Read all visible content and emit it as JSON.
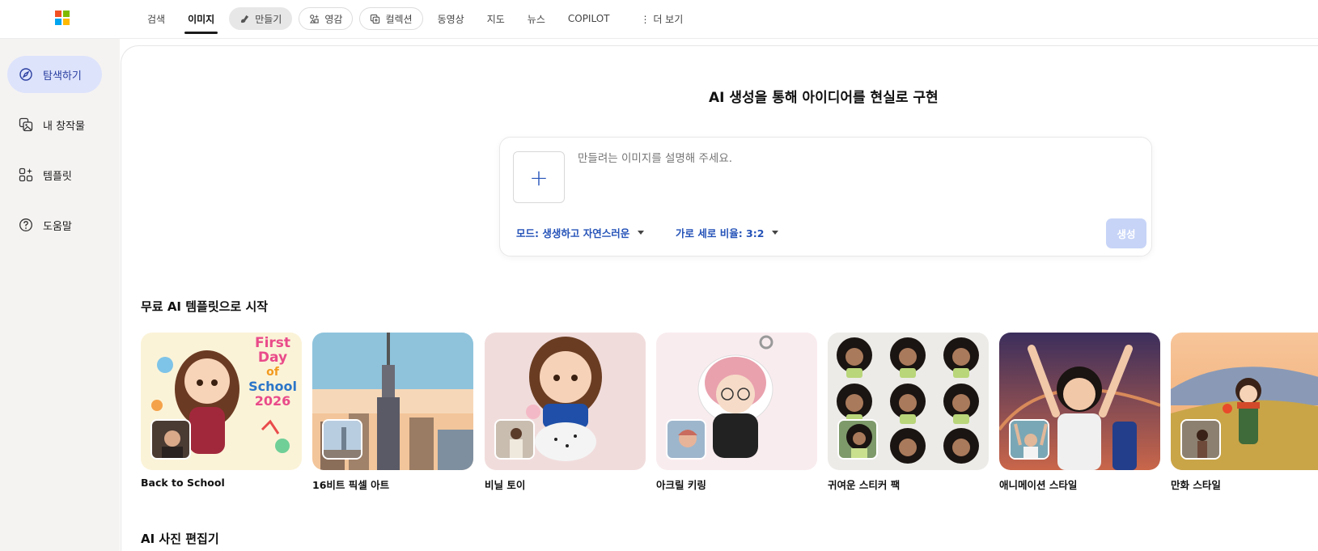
{
  "colors": {
    "accent": "#2553b8",
    "sidebar_active": "#dde3fb",
    "generate_disabled": "#c7d4f7",
    "logo": [
      "#f25022",
      "#7fba00",
      "#00a4ef",
      "#ffb900"
    ]
  },
  "nav": {
    "tabs": [
      {
        "label": "검색"
      },
      {
        "label": "이미지"
      },
      {
        "label": "만들기"
      },
      {
        "label": "영감"
      },
      {
        "label": "컬렉션"
      },
      {
        "label": "동영상"
      },
      {
        "label": "지도"
      },
      {
        "label": "뉴스"
      },
      {
        "label": "COPILOT"
      },
      {
        "label": "⋮ 더 보기"
      }
    ]
  },
  "sidebar": {
    "items": [
      {
        "label": "탐색하기",
        "icon": "compass-icon"
      },
      {
        "label": "내 창작물",
        "icon": "gallery-icon"
      },
      {
        "label": "템플릿",
        "icon": "template-icon"
      },
      {
        "label": "도움말",
        "icon": "help-icon"
      }
    ]
  },
  "hero": {
    "title": "AI 생성을 통해 아이디어를 현실로 구현"
  },
  "prompt": {
    "placeholder": "만들려는 이미지를 설명해 주세요.",
    "add_label": "+",
    "mode_label": "모드: 생생하고 자연스러운",
    "ratio_label": "가로 세로 비율: 3:2",
    "generate_label": "생성"
  },
  "templates": {
    "title": "무료 AI 템플릿으로 시작",
    "cards": [
      {
        "label": "Back to School",
        "art": [
          "First",
          "Day",
          "of",
          "School",
          "2026"
        ]
      },
      {
        "label": "16비트 픽셀 아트"
      },
      {
        "label": "비닐 토이"
      },
      {
        "label": "아크릴 키링"
      },
      {
        "label": "귀여운 스티커 팩"
      },
      {
        "label": "애니메이션 스타일"
      },
      {
        "label": "만화 스타일"
      }
    ]
  },
  "editor": {
    "title": "AI 사진 편집기"
  }
}
